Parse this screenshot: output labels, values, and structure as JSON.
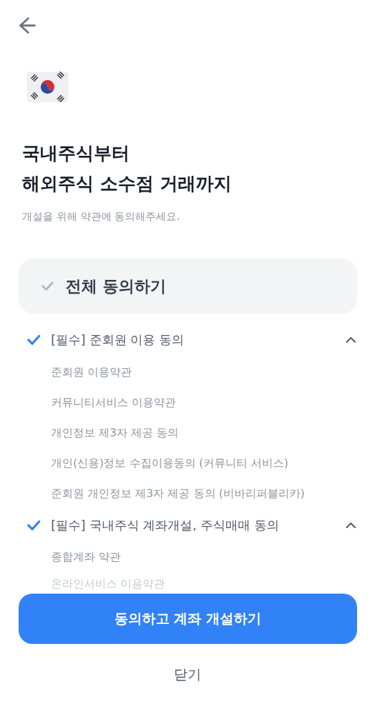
{
  "title_lines": [
    "국내주식부터",
    "해외주식 소수점 거래까지"
  ],
  "subtitle": "개설을 위해 약관에 동의해주세요.",
  "agree_all": {
    "label": "전체 동의하기",
    "checked": false
  },
  "sections": [
    {
      "label": "[필수] 준회원 이용 동의",
      "checked": true,
      "expanded": true,
      "items": [
        "준회원 이용약관",
        "커뮤니티서비스 이용약관",
        "개인정보 제3자 제공 동의",
        "개인(신용)정보 수집이용동의 (커뮤니티 서비스)",
        "준회원 개인정보 제3자 제공 동의 (비바리퍼블리카)"
      ]
    },
    {
      "label": "[필수] 국내주식 계좌개설, 주식매매 동의",
      "checked": true,
      "expanded": true,
      "items": [
        "종합계좌 약관",
        "온라인서비스 이용약관"
      ]
    }
  ],
  "primary_button": "동의하고 계좌 개설하기",
  "close_button": "닫기"
}
